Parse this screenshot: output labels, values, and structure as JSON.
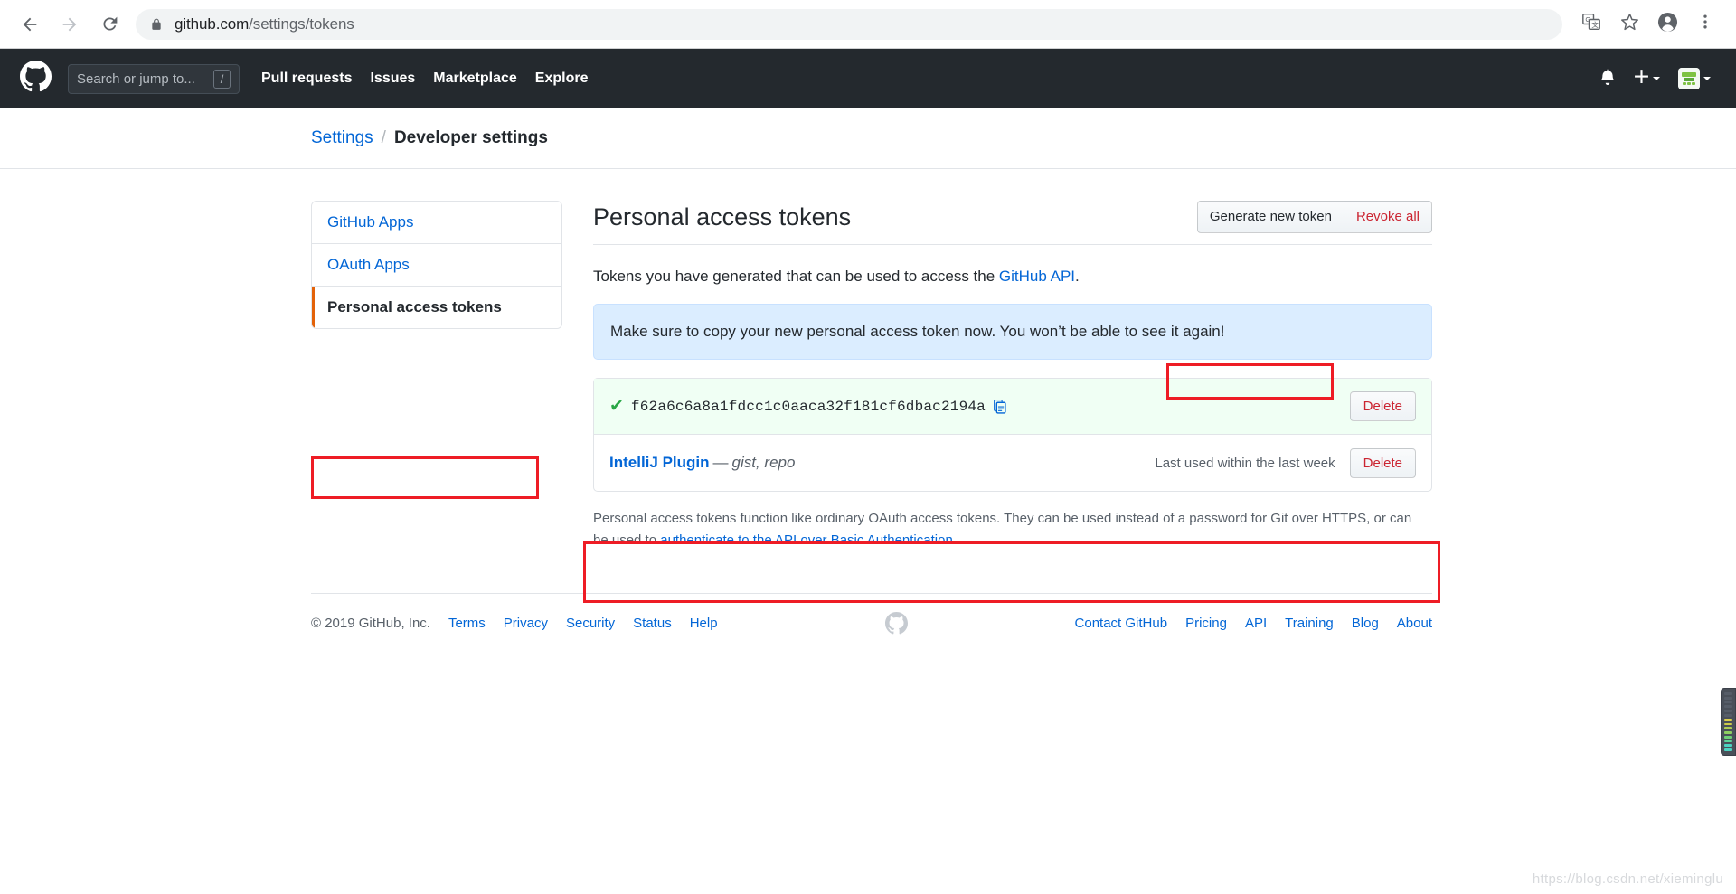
{
  "browser": {
    "back_icon": "back-arrow-icon",
    "forward_icon": "forward-arrow-icon",
    "reload_icon": "reload-icon",
    "lock_icon": "lock-icon",
    "url_domain": "github.com",
    "url_path": "/settings/tokens",
    "translate_icon": "translate-icon",
    "bookmark_icon": "star-icon",
    "profile_icon": "profile-avatar-icon",
    "menu_icon": "three-dot-menu-icon"
  },
  "gh_header": {
    "logo": "github-mark-icon",
    "search_placeholder": "Search or jump to...",
    "search_shortcut": "/",
    "nav": [
      {
        "label": "Pull requests"
      },
      {
        "label": "Issues"
      },
      {
        "label": "Marketplace"
      },
      {
        "label": "Explore"
      }
    ],
    "notification_icon": "bell-icon",
    "create_new_icon": "plus-icon",
    "avatar_icon": "user-avatar-icon"
  },
  "breadcrumb": {
    "parent": "Settings",
    "separator": "/",
    "current": "Developer settings"
  },
  "sidebar": {
    "items": [
      {
        "label": "GitHub Apps",
        "selected": false
      },
      {
        "label": "OAuth Apps",
        "selected": false
      },
      {
        "label": "Personal access tokens",
        "selected": true
      }
    ]
  },
  "main": {
    "title": "Personal access tokens",
    "generate_label": "Generate new token",
    "revoke_label": "Revoke all",
    "intro_prefix": "Tokens you have generated that can be used to access the ",
    "intro_link": "GitHub API",
    "intro_suffix": ".",
    "flash_message": "Make sure to copy your new personal access token now. You won’t be able to see it again!",
    "new_token": {
      "check": "✔",
      "value": "f62a6c6a8a1fdcc1c0aaca32f181cf6dbac2194a",
      "copy_icon": "clipboard-copy-icon",
      "delete_label": "Delete"
    },
    "existing_token": {
      "name": "IntelliJ Plugin",
      "dash": "—",
      "scopes": "gist, repo",
      "last_used": "Last used within the last week",
      "delete_label": "Delete"
    },
    "footnote_part1": "Personal access tokens function like ordinary OAuth access tokens. They can be used instead of a password for Git over HTTPS, or can be used to ",
    "footnote_link": "authenticate to the API over Basic Authentication",
    "footnote_part2": "."
  },
  "footer": {
    "copyright": "© 2019 GitHub, Inc.",
    "left_links": [
      {
        "label": "Terms"
      },
      {
        "label": "Privacy"
      },
      {
        "label": "Security"
      },
      {
        "label": "Status"
      },
      {
        "label": "Help"
      }
    ],
    "logo": "github-mark-footer-icon",
    "right_links": [
      {
        "label": "Contact GitHub"
      },
      {
        "label": "Pricing"
      },
      {
        "label": "API"
      },
      {
        "label": "Training"
      },
      {
        "label": "Blog"
      },
      {
        "label": "About"
      }
    ]
  },
  "overlay": {
    "watermark": "https://blog.csdn.net/xieminglu",
    "level_widget": "audio-level-meter-icon"
  },
  "colors": {
    "header_bg": "#24292e",
    "link_blue": "#0366d6",
    "danger_red": "#cb2431",
    "annotation_red": "#ee1c25",
    "flash_bg": "#dbedff",
    "success_bg": "#f0fff4",
    "success_green": "#28a745",
    "selected_orange": "#e36209"
  }
}
